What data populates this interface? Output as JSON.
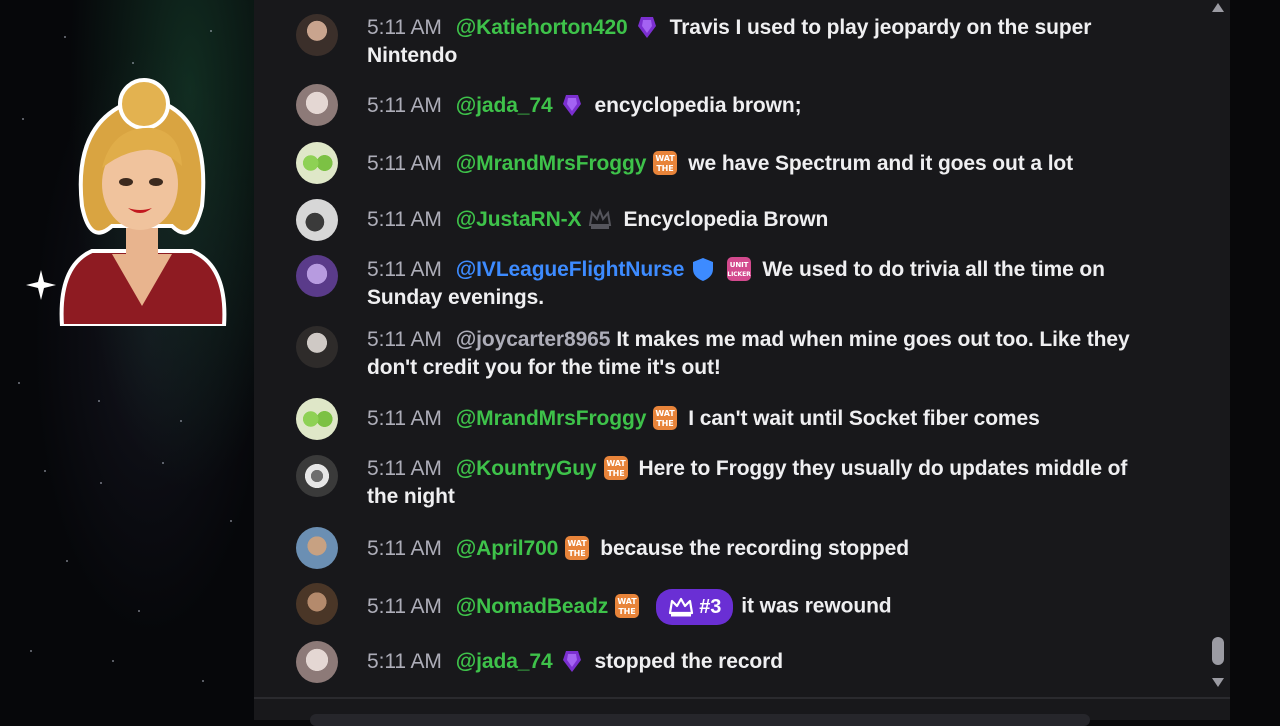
{
  "theme": {
    "chat_bg": "#18181b",
    "text_color": "#efeff1",
    "timestamp_color": "#adadb8",
    "username_green": "#3ec24a",
    "username_blue": "#3d8bff",
    "rank_chip_color": "#6a2fd4"
  },
  "messages": [
    {
      "time": "5:11 AM",
      "user": "@Katiehorton420",
      "user_color": "#3ec24a",
      "badges": [
        "purple-gem-badge-icon"
      ],
      "text": "Travis I used to play jeopardy on the super Nintendo"
    },
    {
      "time": "5:11 AM",
      "user": "@jada_74",
      "user_color": "#3ec24a",
      "badges": [
        "purple-gem-badge-icon"
      ],
      "text": "encyclopedia brown;"
    },
    {
      "time": "5:11 AM",
      "user": "@MrandMrsFroggy",
      "user_color": "#3ec24a",
      "badges": [
        "wat-the-badge-icon"
      ],
      "text": "we have Spectrum and it goes out a lot"
    },
    {
      "time": "5:11 AM",
      "user": "@JustaRN-X",
      "user_color": "#3ec24a",
      "badges": [
        "crown-badge-icon"
      ],
      "text": "Encyclopedia Brown"
    },
    {
      "time": "5:11 AM",
      "user": "@IVLeagueFlightNurse",
      "user_color": "#3d8bff",
      "badges": [
        "shield-badge-icon",
        "unit-licker-badge-icon"
      ],
      "text": "We used to do trivia all the time on Sunday evenings."
    },
    {
      "time": "5:11 AM",
      "user": "@joycarter8965",
      "user_color": "#adadb8",
      "badges": [],
      "text": "It makes me mad when mine goes out too. Like they don't credit you for the time it's out!"
    },
    {
      "time": "5:11 AM",
      "user": "@MrandMrsFroggy",
      "user_color": "#3ec24a",
      "badges": [
        "wat-the-badge-icon"
      ],
      "text": "I can't wait until Socket fiber comes"
    },
    {
      "time": "5:11 AM",
      "user": "@KountryGuy",
      "user_color": "#3ec24a",
      "badges": [
        "wat-the-badge-icon"
      ],
      "text": "Here to Froggy they usually do updates middle of the night"
    },
    {
      "time": "5:11 AM",
      "user": "@April700",
      "user_color": "#3ec24a",
      "badges": [
        "wat-the-badge-icon"
      ],
      "text": "because the recording stopped"
    },
    {
      "time": "5:11 AM",
      "user": "@NomadBeadz",
      "user_color": "#3ec24a",
      "badges": [
        "wat-the-badge-icon"
      ],
      "rank": "#3",
      "text": "it was rewound"
    },
    {
      "time": "5:11 AM",
      "user": "@jada_74",
      "user_color": "#3ec24a",
      "badges": [
        "purple-gem-badge-icon"
      ],
      "text": "stopped the record"
    }
  ]
}
